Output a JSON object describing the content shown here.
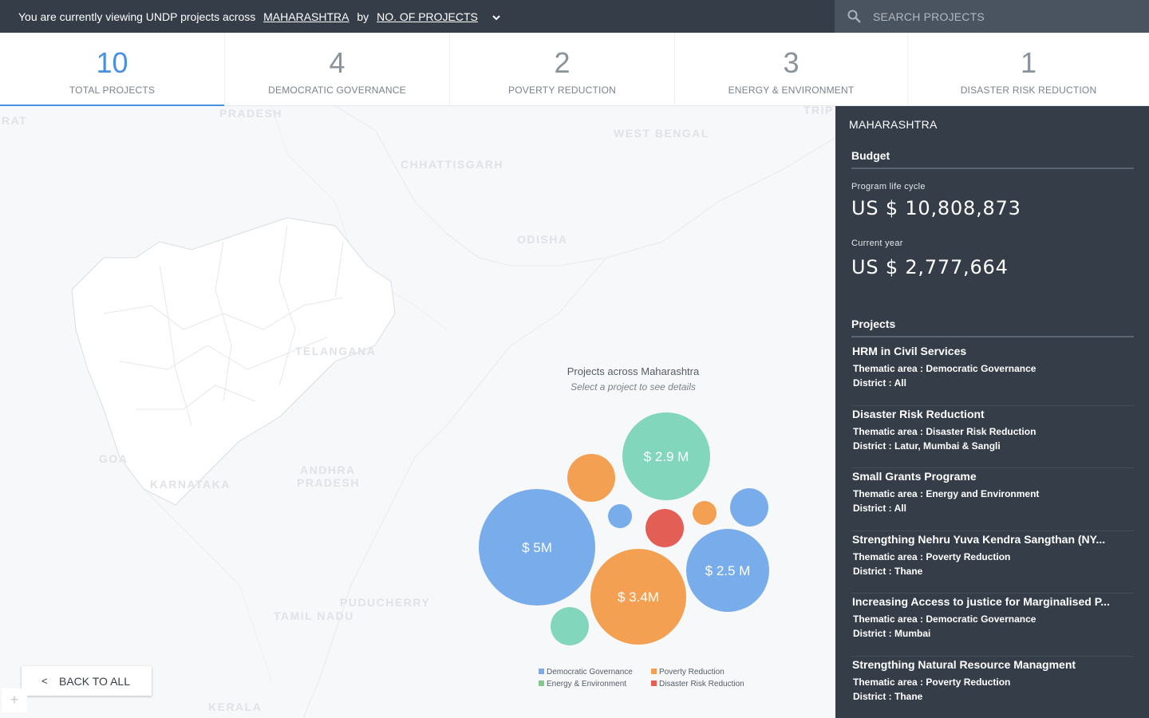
{
  "topbar": {
    "prefix": "You are currently viewing UNDP projects across",
    "state": "MAHARASHTRA",
    "by": "by",
    "metric": "NO. OF PROJECTS",
    "chevron_icon": "chevron-down-icon"
  },
  "search": {
    "placeholder": "SEARCH PROJECTS",
    "icon": "search-icon"
  },
  "stats": [
    {
      "value": "10",
      "label": "TOTAL PROJECTS",
      "active": true
    },
    {
      "value": "4",
      "label": "DEMOCRATIC GOVERNANCE"
    },
    {
      "value": "2",
      "label": "POVERTY REDUCTION"
    },
    {
      "value": "3",
      "label": "ENERGY & ENVIRONMENT"
    },
    {
      "value": "1",
      "label": "DISASTER RISK REDUCTION"
    }
  ],
  "map_labels": [
    "RAT",
    "PRADESH",
    "WEST BENGAL",
    "CHHATTISGARH",
    "ODISHA",
    "TELANGANA",
    "GOA",
    "KARNATAKA",
    "ANDHRA",
    "PRADESH",
    "PUDUCHERRY",
    "TAMIL NADU",
    "KERALA",
    "TRIP"
  ],
  "chart_data": {
    "type": "bubble",
    "title": "Projects across Maharashtra",
    "subtitle": "Select a project to see details",
    "bubbles": [
      {
        "label": "$ 5M",
        "category": "Democratic Governance",
        "color": "#78acea"
      },
      {
        "label": "$ 3.4M",
        "category": "Poverty Reduction",
        "color": "#f3a052"
      },
      {
        "label": "$ 2.9 M",
        "category": "Energy & Environment",
        "color": "#82d6bb"
      },
      {
        "label": "$ 2.5 M",
        "category": "Democratic Governance",
        "color": "#78acea"
      },
      {
        "label": "",
        "category": "Poverty Reduction",
        "color": "#f3a052"
      },
      {
        "label": "",
        "category": "Energy & Environment",
        "color": "#82d6bb"
      },
      {
        "label": "",
        "category": "Democratic Governance",
        "color": "#78acea"
      },
      {
        "label": "",
        "category": "Democratic Governance",
        "color": "#78acea"
      },
      {
        "label": "",
        "category": "Disaster Risk Reduction",
        "color": "#e35f56"
      },
      {
        "label": "",
        "category": "Poverty Reduction",
        "color": "#f3a052"
      }
    ],
    "legend": [
      {
        "name": "Democratic Governance",
        "color": "#78acea"
      },
      {
        "name": "Poverty Reduction",
        "color": "#f3a052"
      },
      {
        "name": "Energy & Environment",
        "color": "#82c98a"
      },
      {
        "name": "Disaster Risk Reduction",
        "color": "#e35f56"
      }
    ]
  },
  "back_button": {
    "arrow": "<",
    "label": "BACK TO ALL"
  },
  "zoom": {
    "plus": "+"
  },
  "panel": {
    "title": "MAHARASHTRA",
    "budget_heading": "Budget",
    "life_cycle_label": "Program life cycle",
    "life_cycle_value": "US $ 10,808,873",
    "current_year_label": "Current year",
    "current_year_value": "US $ 2,777,664",
    "projects_heading": "Projects",
    "projects": [
      {
        "name": "HRM in Civil Services",
        "thematic": "Thematic area : Democratic Governance",
        "district": "District : All"
      },
      {
        "name": "Disaster Risk Reductiont",
        "thematic": "Thematic area : Disaster Risk Reduction",
        "district": "District : Latur, Mumbai & Sangli"
      },
      {
        "name": "Small Grants Programe",
        "thematic": "Thematic area : Energy and Environment",
        "district": "District : All"
      },
      {
        "name": "Strengthing Nehru Yuva Kendra Sangthan (NY...",
        "thematic": "Thematic area : Poverty Reduction",
        "district": "District : Thane"
      },
      {
        "name": "Increasing Access to justice for Marginalised P...",
        "thematic": "Thematic area : Democratic Governance",
        "district": "District : Mumbai"
      },
      {
        "name": "Strengthing Natural Resource Managment",
        "thematic": "Thematic area : Poverty Reduction",
        "district": "District : Thane"
      }
    ]
  }
}
